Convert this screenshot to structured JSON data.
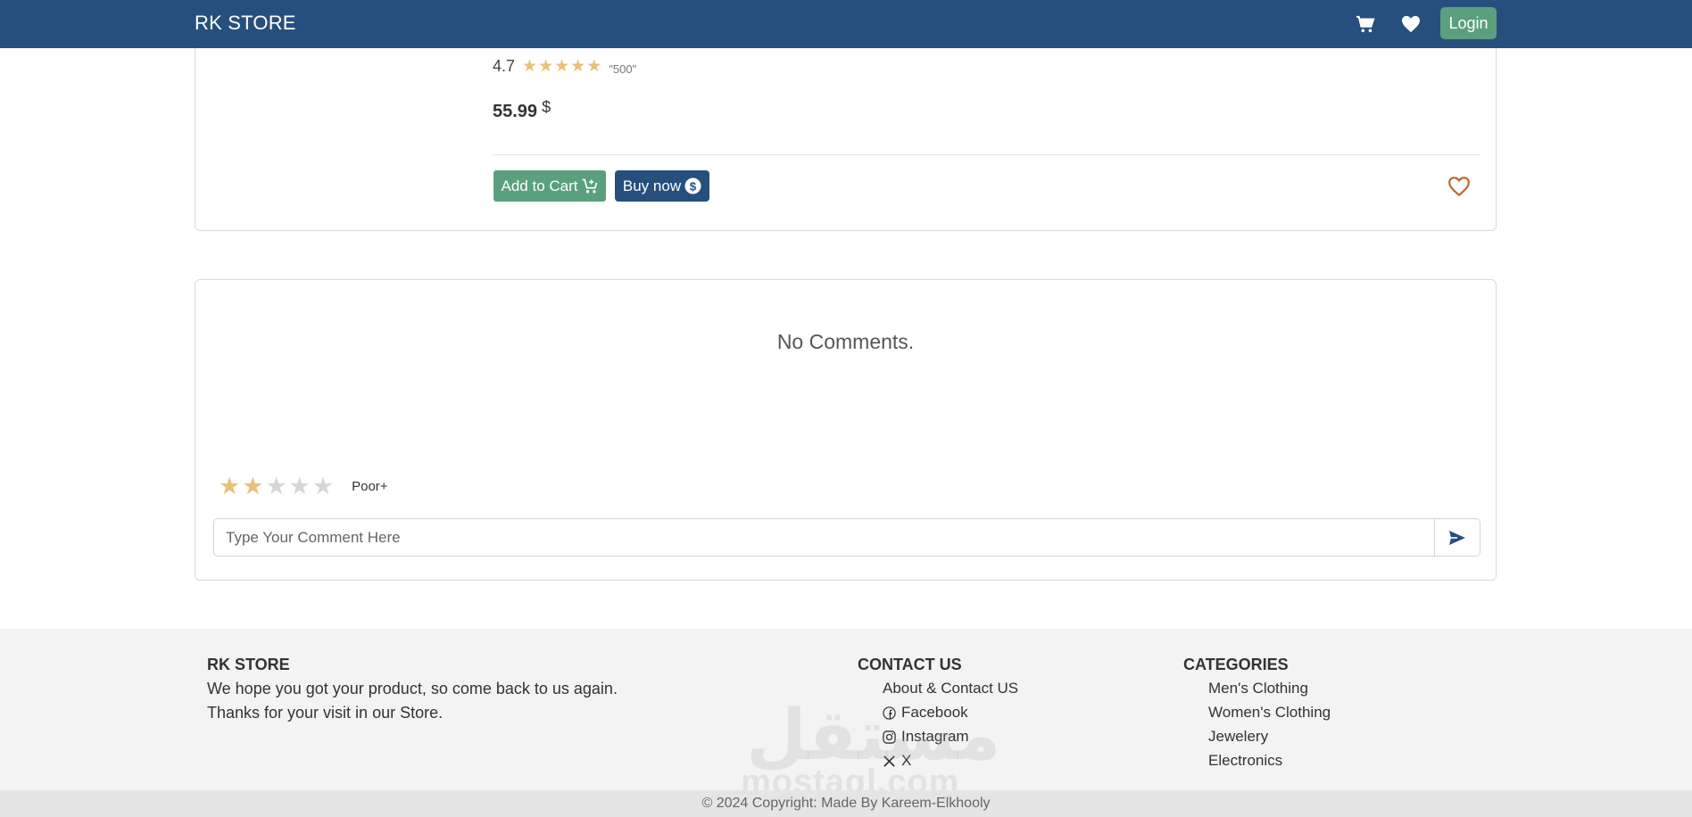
{
  "navbar": {
    "brand": "RK STORE",
    "cart_icon": "cart-icon",
    "heart_icon": "heart-icon",
    "login_label": "Login",
    "bg_color": "#274f7d"
  },
  "product": {
    "rating_value": "4.7",
    "rating_stars": 5,
    "rating_count": "\"500\"",
    "price": "55.99",
    "currency": "$",
    "add_to_cart_label": "Add to Cart",
    "buy_now_label": "Buy now"
  },
  "comments": {
    "empty_text": "No Comments.",
    "rating_selected": 2,
    "rating_max": 5,
    "rating_label": "Poor+",
    "input_placeholder": "Type Your Comment Here",
    "send_icon": "send-icon"
  },
  "footer": {
    "store": {
      "title": "RK STORE",
      "line1": "We hope you got your product, so come back to us again.",
      "line2": "Thanks for your visit in our Store."
    },
    "contact": {
      "title": "CONTACT US",
      "links": [
        {
          "label": "About & Contact US",
          "icon": ""
        },
        {
          "label": "Facebook",
          "icon": "facebook-icon"
        },
        {
          "label": "Instagram",
          "icon": "instagram-icon"
        },
        {
          "label": "X",
          "icon": "x-icon"
        }
      ]
    },
    "categories": {
      "title": "CATEGORIES",
      "items": [
        "Men's Clothing",
        "Women's Clothing",
        "Jewelery",
        "Electronics"
      ]
    },
    "copyright": "© 2024 Copyright: Made By Kareem-Elkhooly"
  },
  "watermark": {
    "arabic": "مستقل",
    "latin": "mostaql.com"
  },
  "colors": {
    "primary": "#274f7d",
    "success": "#5aa07c",
    "star": "#e8c07a",
    "wish": "#c0652e"
  }
}
